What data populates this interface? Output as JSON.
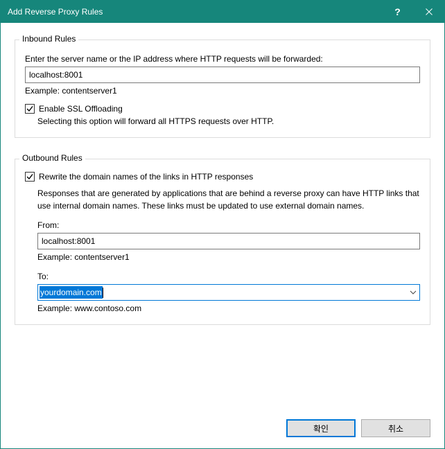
{
  "window": {
    "title": "Add Reverse Proxy Rules"
  },
  "inbound": {
    "legend": "Inbound Rules",
    "prompt": "Enter the server name or the IP address where HTTP requests will be forwarded:",
    "server_value": "localhost:8001",
    "example": "Example: contentserver1",
    "ssl_checkbox_label": "Enable SSL Offloading",
    "ssl_checked": true,
    "ssl_desc": "Selecting this option will forward all HTTPS requests over HTTP."
  },
  "outbound": {
    "legend": "Outbound Rules",
    "rewrite_checkbox_label": "Rewrite the domain names of the links in HTTP responses",
    "rewrite_checked": true,
    "desc1": "Responses that are generated by applications that are behind a reverse proxy can have HTTP links that use internal domain names. These links must be updated to use external domain names.",
    "from_label": "From:",
    "from_value": "localhost:8001",
    "from_example": "Example: contentserver1",
    "to_label": "To:",
    "to_value": "yourdomain.com",
    "to_example": "Example: www.contoso.com"
  },
  "buttons": {
    "ok": "확인",
    "cancel": "취소"
  }
}
